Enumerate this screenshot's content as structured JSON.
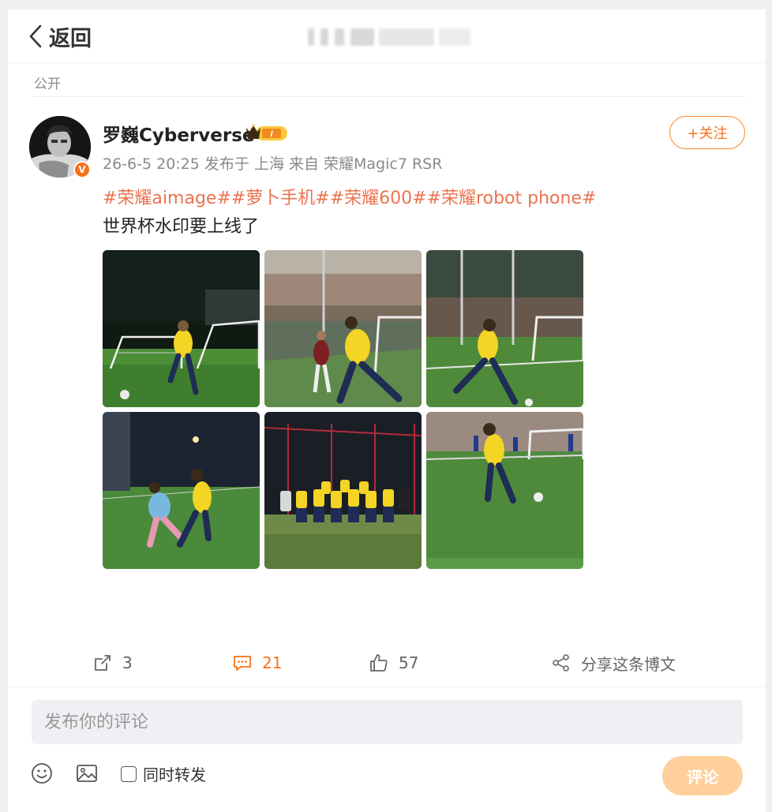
{
  "header": {
    "back_label": "返回",
    "back_icon": "chevron-left-icon"
  },
  "post": {
    "visibility": "公开",
    "author": {
      "name": "罗巍Cyberverse",
      "verified_badge": "V",
      "vip_badge": "crown-vip-icon",
      "vip_level": "I"
    },
    "meta": "26-6-5 20:25 发布于 上海 来自 荣耀Magic7 RSR",
    "follow_label": "+关注",
    "tags": [
      "#荣耀aimage#",
      "#萝卜手机#",
      "#荣耀600#",
      "#荣耀robot phone#"
    ],
    "text": "世界杯水印要上线了",
    "photo_count": 6
  },
  "actions": {
    "forward": {
      "icon": "share-out-icon",
      "count": "3"
    },
    "comment": {
      "icon": "comment-icon",
      "count": "21"
    },
    "like": {
      "icon": "thumbs-up-icon",
      "count": "57"
    },
    "share": {
      "icon": "share-nodes-icon",
      "label": "分享这条博文"
    }
  },
  "composer": {
    "placeholder": "发布你的评论",
    "emoji_icon": "emoji-icon",
    "image_icon": "image-icon",
    "repost_label": "同时转发",
    "submit_label": "评论"
  },
  "colors": {
    "accent": "#f7701b",
    "tag": "#eb7350",
    "submit_bg": "#ffcf9c",
    "input_bg": "#eef0f3",
    "page_bg": "#eef0f2"
  }
}
